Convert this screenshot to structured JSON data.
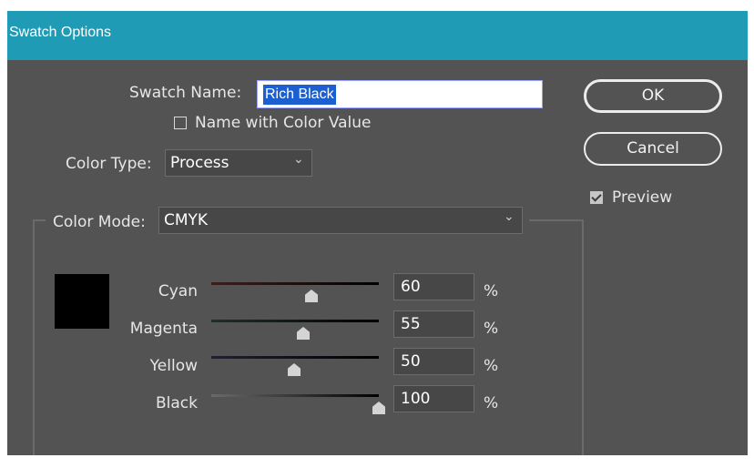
{
  "window": {
    "title": "Swatch Options"
  },
  "swatch_name": {
    "label": "Swatch Name:",
    "value": "Rich Black"
  },
  "name_with_color_value": {
    "label": "Name with Color Value",
    "checked": false
  },
  "color_type": {
    "label": "Color Type:",
    "value": "Process"
  },
  "color_mode": {
    "label": "Color Mode:",
    "value": "CMYK"
  },
  "buttons": {
    "ok": "OK",
    "cancel": "Cancel"
  },
  "preview": {
    "label": "Preview",
    "checked": true
  },
  "preview_swatch_color": "#000000",
  "sliders": [
    {
      "label": "Cyan",
      "value": "60",
      "unit": "%"
    },
    {
      "label": "Magenta",
      "value": "55",
      "unit": "%"
    },
    {
      "label": "Yellow",
      "value": "50",
      "unit": "%"
    },
    {
      "label": "Black",
      "value": "100",
      "unit": "%"
    }
  ],
  "colors": {
    "titlebar": "#1f9bb5",
    "dialog_bg": "#535353",
    "selection": "#1b5fd1"
  }
}
